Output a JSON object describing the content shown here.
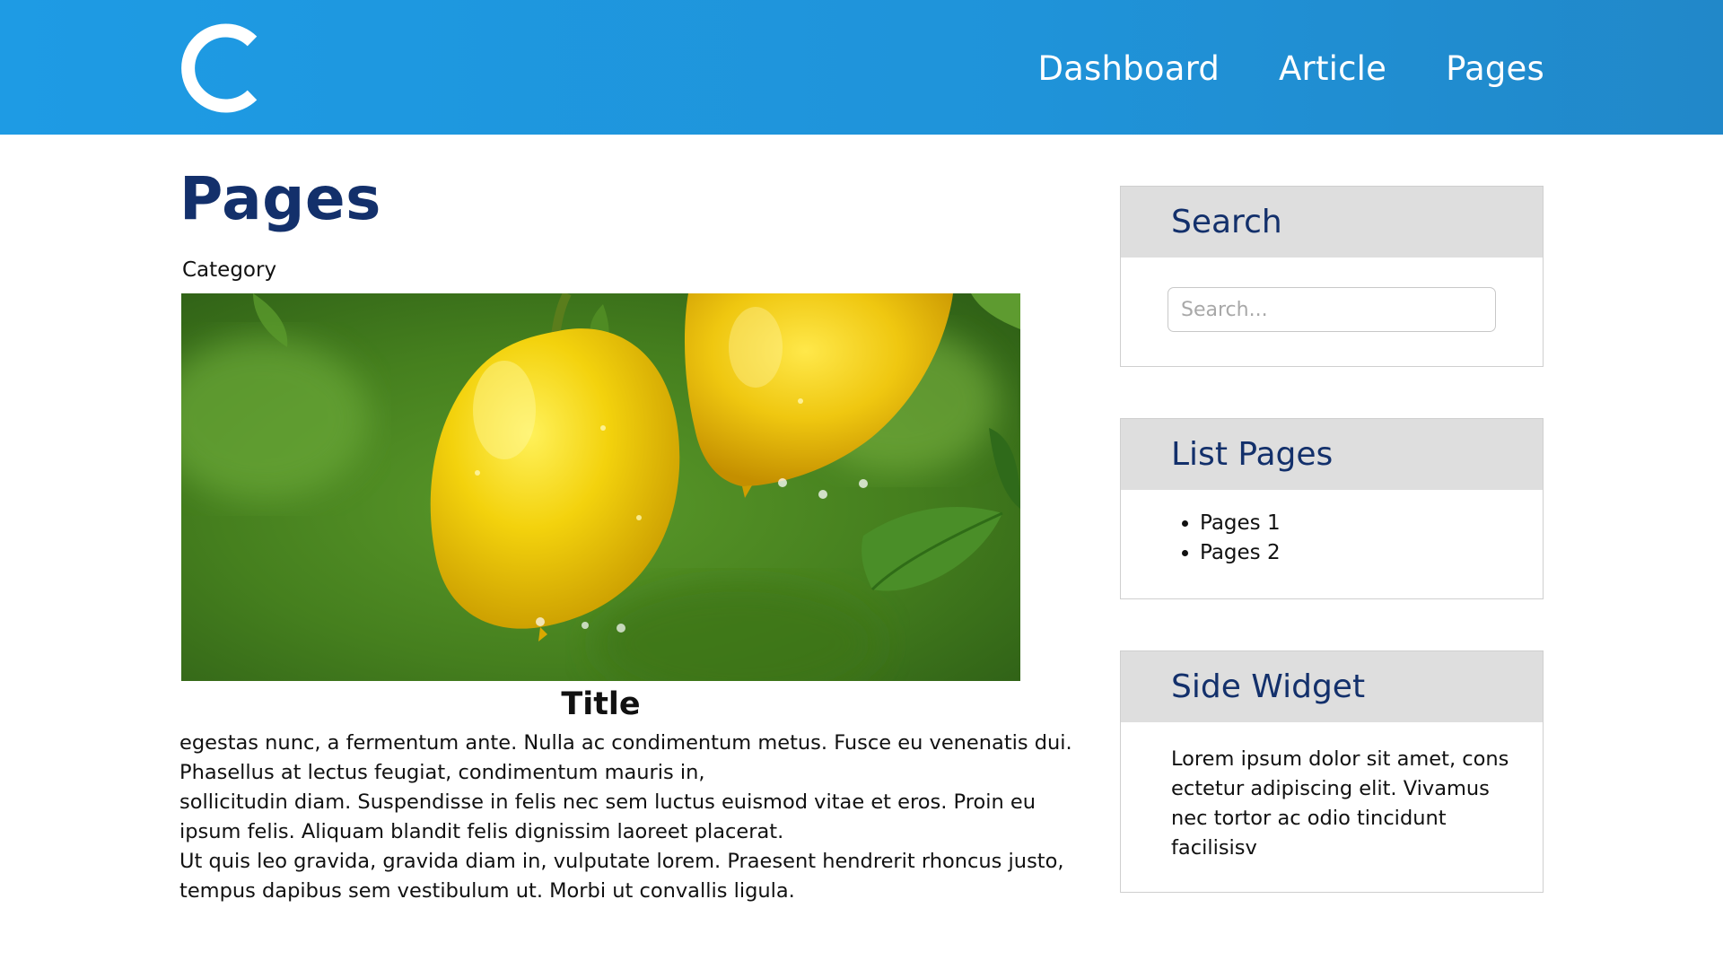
{
  "nav": {
    "items": [
      {
        "label": "Dashboard"
      },
      {
        "label": "Article"
      },
      {
        "label": "Pages"
      }
    ]
  },
  "main": {
    "title": "Pages",
    "category": "Category",
    "article": {
      "title": "Title",
      "lines": [
        "egestas nunc, a fermentum ante. Nulla ac condimentum metus. Fusce eu venenatis dui.",
        "Phasellus at lectus feugiat, condimentum mauris in,",
        " sollicitudin diam. Suspendisse in felis nec sem luctus euismod vitae et eros. Proin eu",
        "ipsum felis. Aliquam blandit felis dignissim laoreet placerat.",
        " Ut quis leo gravida, gravida diam in, vulputate lorem. Praesent hendrerit rhoncus justo,",
        "tempus dapibus sem vestibulum ut. Morbi ut convallis ligula."
      ]
    }
  },
  "sidebar": {
    "search": {
      "title": "Search",
      "placeholder": "Search..."
    },
    "list_pages": {
      "title": "List Pages",
      "items": [
        "Pages 1",
        "Pages 2"
      ]
    },
    "side_widget": {
      "title": "Side Widget",
      "lines": [
        "Lorem ipsum dolor sit amet, cons",
        "ectetur adipiscing elit. Vivamus",
        "nec tortor ac odio tincidunt",
        "facilisisv"
      ]
    }
  },
  "colors": {
    "header_bg": "#1e9be4",
    "heading": "#13306b",
    "widget_head_bg": "#dedede"
  },
  "icons": {
    "logo": "letter-c-logo-icon"
  }
}
